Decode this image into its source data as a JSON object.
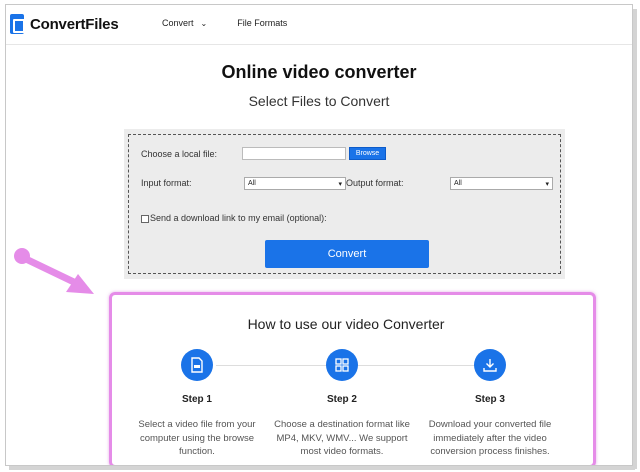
{
  "header": {
    "brand": "ConvertFiles",
    "nav": [
      {
        "label": "Convert",
        "has_dropdown": true
      },
      {
        "label": "File Formats",
        "has_dropdown": false
      }
    ]
  },
  "main": {
    "title": "Online video converter",
    "subtitle": "Select Files to Convert"
  },
  "form": {
    "local_file_label": "Choose a local file:",
    "browse_label": "Browse",
    "input_format_label": "Input format:",
    "input_format_value": "All",
    "output_format_label": "Output format:",
    "output_format_value": "All",
    "email_label": "Send a download link to my email (optional):",
    "email_checked": false,
    "convert_label": "Convert"
  },
  "howto": {
    "title": "How to use our video Converter",
    "steps": [
      {
        "title": "Step 1",
        "desc": "Select a video file from your computer using the browse function.",
        "icon": "file-icon"
      },
      {
        "title": "Step 2",
        "desc": "Choose a destination format like MP4, MKV, WMV... We support most video formats.",
        "icon": "grid-icon"
      },
      {
        "title": "Step 3",
        "desc": "Download your converted file immediately after the video conversion process finishes.",
        "icon": "download-icon"
      }
    ]
  },
  "colors": {
    "accent": "#1a73e8",
    "highlight": "#e58ce8"
  }
}
